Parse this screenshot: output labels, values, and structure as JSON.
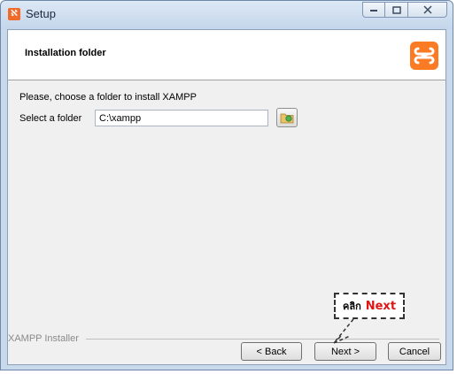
{
  "window": {
    "title": "Setup",
    "controls": [
      "minimize-icon",
      "maximize-icon",
      "close-icon"
    ]
  },
  "header": {
    "title": "Installation folder",
    "logo": "xampp-logo"
  },
  "content": {
    "instruction": "Please, choose a folder to install XAMPP",
    "folder_label": "Select a folder",
    "folder_value": "C:\\xampp",
    "browse_icon": "folder-browse-icon"
  },
  "footer": {
    "label": "XAMPP Installer",
    "back_label": "< Back",
    "next_label": "Next >",
    "cancel_label": "Cancel"
  },
  "annotation": {
    "prefix": "คลิก",
    "accent": "Next",
    "accent_color": "#e01515"
  },
  "colors": {
    "brand": "#fb7a24",
    "client_bg": "#f0f0f0",
    "title_bar": "#c8d9ec"
  }
}
